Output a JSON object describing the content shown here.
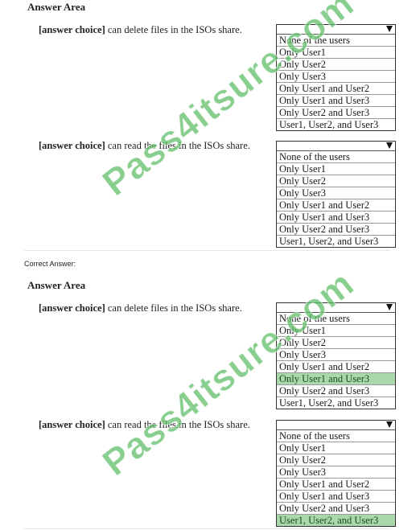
{
  "sections": [
    {
      "title": "Answer Area",
      "questions": [
        {
          "prefix": "[answer choice]",
          "text": " can delete files in the ISOs share.",
          "options": [
            "None of the users",
            "Only User1",
            "Only User2",
            "Only User3",
            "Only User1 and User2",
            "Only User1 and User3",
            "Only User2 and User3",
            "User1, User2, and User3"
          ],
          "selected_index": null
        },
        {
          "prefix": "[answer choice]",
          "text": " can read the files in the ISOs share.",
          "options": [
            "None of the users",
            "Only User1",
            "Only User2",
            "Only User3",
            "Only User1 and User2",
            "Only User1 and User3",
            "Only User2 and User3",
            "User1, User2, and User3"
          ],
          "selected_index": null
        }
      ]
    },
    {
      "label": "Correct Answer:",
      "title": "Answer Area",
      "questions": [
        {
          "prefix": "[answer choice]",
          "text": " can delete files in the ISOs share.",
          "options": [
            "None of the users",
            "Only User1",
            "Only User2",
            "Only User3",
            "Only User1 and User2",
            "Only User1 and User3",
            "Only User2 and User3",
            "User1, User2, and User3"
          ],
          "selected_index": 5,
          "selected_value": "Only User1 and User3"
        },
        {
          "prefix": "[answer choice]",
          "text": " can read the files in the ISOs share.",
          "options": [
            "None of the users",
            "Only User1",
            "Only User2",
            "Only User3",
            "Only User1 and User2",
            "Only User1 and User3",
            "Only User2 and User3",
            "User1, User2, and User3"
          ],
          "selected_index": 7,
          "selected_value": "User1, User2, and User3"
        }
      ]
    }
  ],
  "watermark": "Pass4itsure.com",
  "colors": {
    "selected_bg": "#a9d8ad",
    "watermark": "#60be68"
  },
  "icons": {
    "dropdown_arrow": "triangle-down-icon"
  }
}
